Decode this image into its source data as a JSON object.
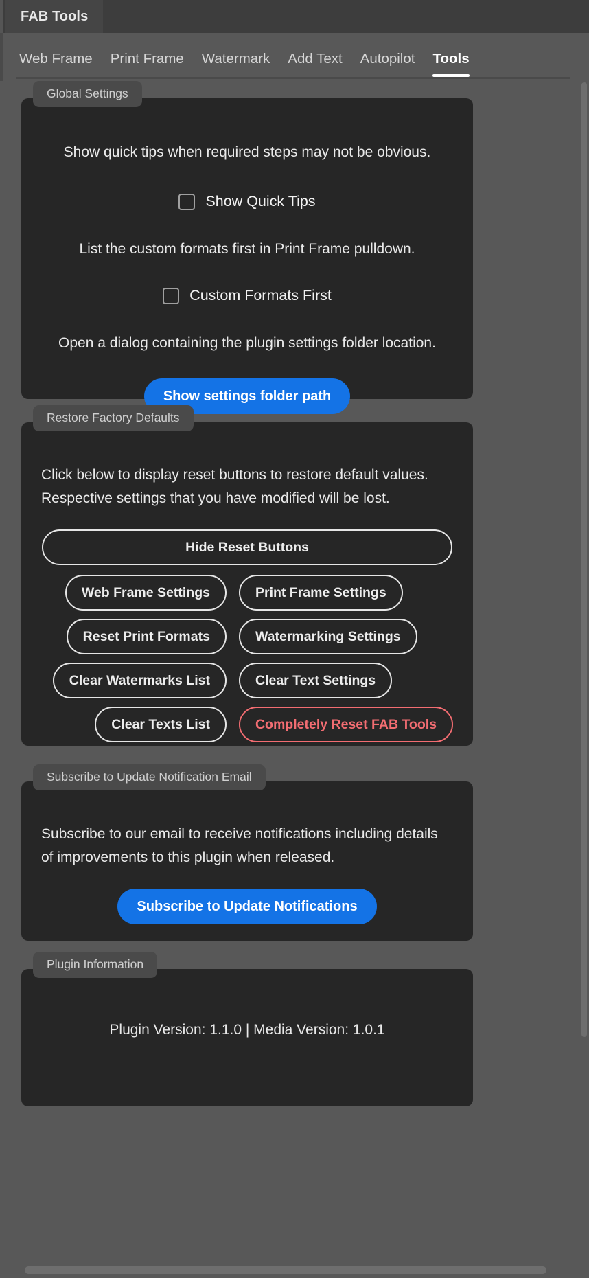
{
  "window": {
    "tab_label": "FAB Tools"
  },
  "nav": {
    "tabs": [
      {
        "label": "Web Frame",
        "active": false
      },
      {
        "label": "Print Frame",
        "active": false
      },
      {
        "label": "Watermark",
        "active": false
      },
      {
        "label": "Add Text",
        "active": false
      },
      {
        "label": "Autopilot",
        "active": false
      },
      {
        "label": "Tools",
        "active": true
      }
    ]
  },
  "colors": {
    "accent_blue": "#1473E6",
    "danger_red": "#F36D72",
    "panel_bg": "#262626",
    "app_bg": "#585858",
    "titlebar_bg": "#3d3d3d",
    "header_chip_bg": "#4a4a4a"
  },
  "global_settings": {
    "header": "Global Settings",
    "quick_tips_description": "Show quick tips when required steps may not be obvious.",
    "quick_tips_checkbox_label": "Show Quick Tips",
    "quick_tips_checked": false,
    "custom_formats_description": "List the custom formats first in Print Frame pulldown.",
    "custom_formats_checkbox_label": "Custom Formats First",
    "custom_formats_checked": false,
    "settings_folder_description": "Open a dialog containing the plugin settings folder location.",
    "settings_folder_button": "Show settings folder path"
  },
  "restore_defaults": {
    "header": "Restore Factory Defaults",
    "description_line1": "Click below to display reset buttons to restore default values.",
    "description_line2": "Respective settings that you have modified will be lost.",
    "toggle_button": "Hide Reset Buttons",
    "buttons": [
      {
        "label": "Web Frame Settings",
        "danger": false
      },
      {
        "label": "Print Frame Settings",
        "danger": false
      },
      {
        "label": "Reset Print Formats",
        "danger": false
      },
      {
        "label": "Watermarking Settings",
        "danger": false
      },
      {
        "label": "Clear Watermarks List",
        "danger": false
      },
      {
        "label": "Clear Text Settings",
        "danger": false
      },
      {
        "label": "Clear Texts List",
        "danger": false
      },
      {
        "label": "Completely Reset FAB Tools",
        "danger": true
      }
    ]
  },
  "subscribe": {
    "header": "Subscribe to Update Notification Email",
    "description_line1": "Subscribe to our email to receive notifications including details",
    "description_line2": "of improvements to this plugin when released.",
    "button": "Subscribe to Update Notifications"
  },
  "plugin_info": {
    "header": "Plugin Information",
    "version_text": "Plugin Version: 1.1.0 | Media Version: 1.0.1"
  }
}
